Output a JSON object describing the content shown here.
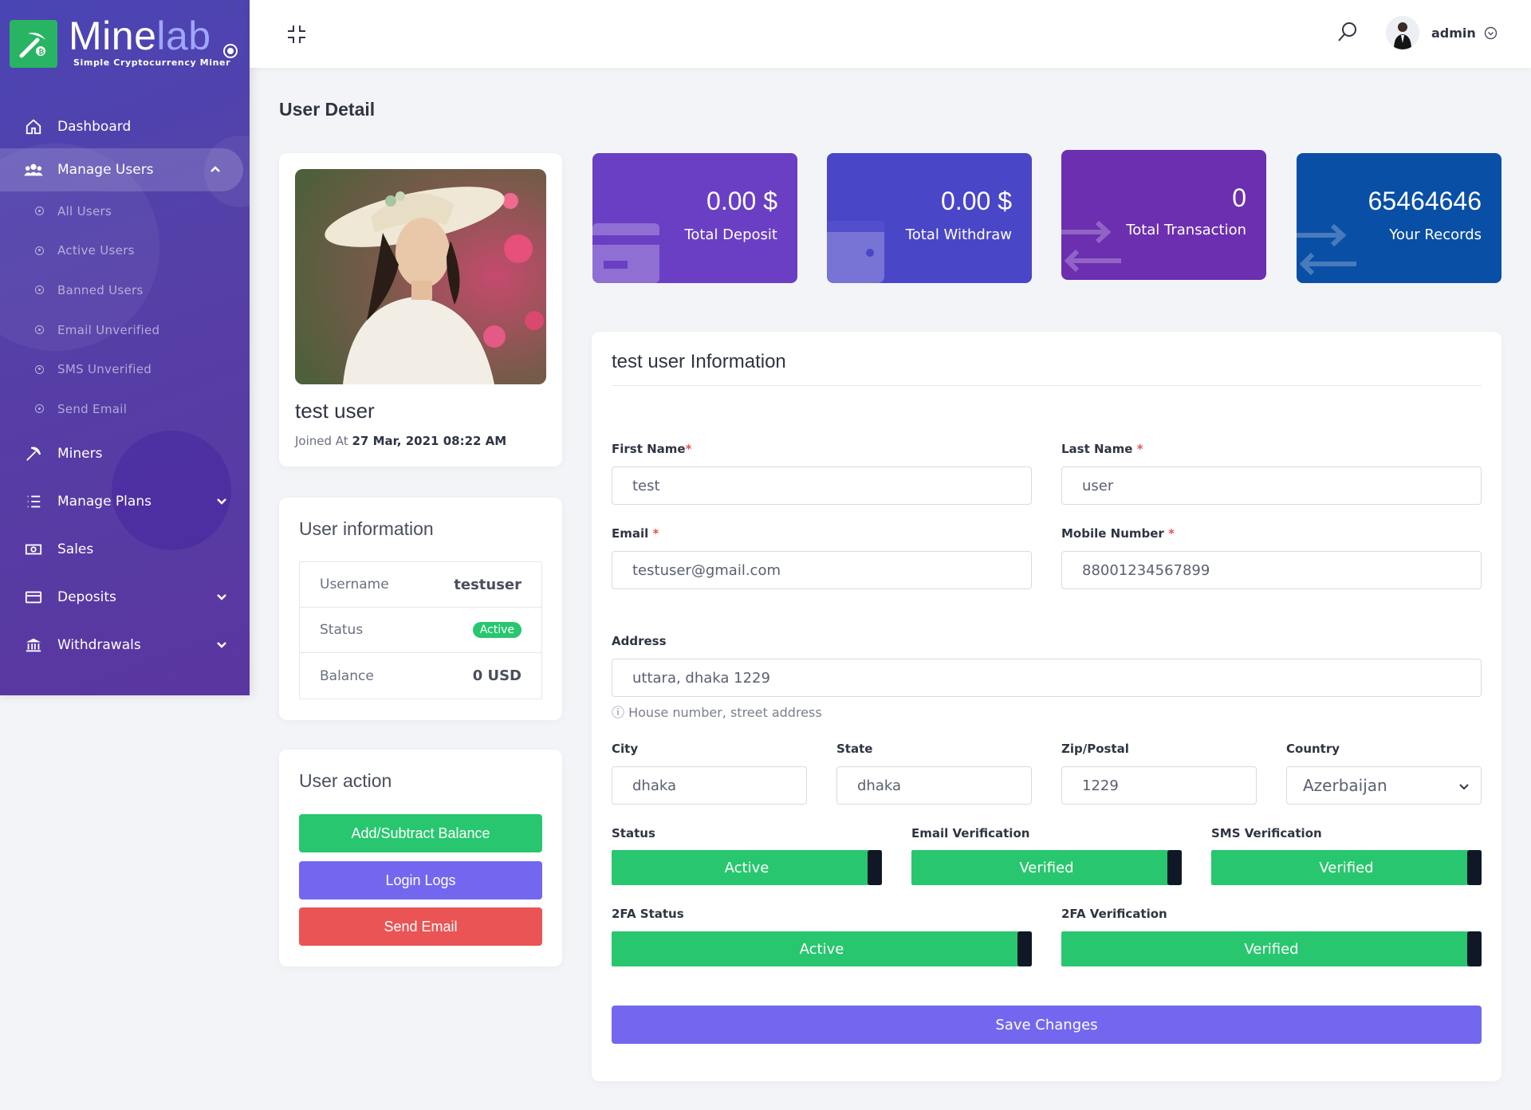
{
  "brand": {
    "name_main": "Mine",
    "name_accent": "lab",
    "tagline": "Simple Cryptocurrency Miner"
  },
  "sidebar": {
    "items": [
      {
        "label": "Dashboard",
        "icon": "home-icon"
      },
      {
        "label": "Manage Users",
        "icon": "users-icon"
      },
      {
        "label": "Miners",
        "icon": "pickaxe-icon"
      },
      {
        "label": "Manage Plans",
        "icon": "list-icon"
      },
      {
        "label": "Sales",
        "icon": "money-icon"
      },
      {
        "label": "Deposits",
        "icon": "credit-card-icon"
      },
      {
        "label": "Withdrawals",
        "icon": "bank-icon"
      }
    ],
    "subitems": [
      "All Users",
      "Active Users",
      "Banned Users",
      "Email Unverified",
      "SMS Unverified",
      "Send Email"
    ]
  },
  "header": {
    "username": "admin"
  },
  "page": {
    "title": "User Detail"
  },
  "profile": {
    "name": "test user",
    "joined_prefix": "Joined At",
    "joined_date": "27 Mar, 2021 08:22 AM"
  },
  "user_info": {
    "title": "User information",
    "rows": [
      {
        "label": "Username",
        "value": "testuser"
      },
      {
        "label": "Status",
        "value": "Active"
      },
      {
        "label": "Balance",
        "value": "0 USD"
      }
    ]
  },
  "user_action": {
    "title": "User action",
    "buttons": [
      "Add/Subtract Balance",
      "Login Logs",
      "Send Email"
    ]
  },
  "stats": [
    {
      "value": "0.00 $",
      "label": "Total Deposit"
    },
    {
      "value": "0.00 $",
      "label": "Total Withdraw"
    },
    {
      "value": "0",
      "label": "Total Transaction"
    },
    {
      "value": "65464646",
      "label": "Your Records"
    }
  ],
  "form": {
    "title": "test user Information",
    "first_name": {
      "label": "First Name",
      "value": "test"
    },
    "last_name": {
      "label": "Last Name",
      "value": "user"
    },
    "email": {
      "label": "Email",
      "value": "testuser@gmail.com"
    },
    "mobile": {
      "label": "Mobile Number",
      "value": "88001234567899"
    },
    "address": {
      "label": "Address",
      "value": "uttara, dhaka 1229",
      "hint": "House number, street address"
    },
    "city": {
      "label": "City",
      "value": "dhaka"
    },
    "state": {
      "label": "State",
      "value": "dhaka"
    },
    "zip": {
      "label": "Zip/Postal",
      "value": "1229"
    },
    "country": {
      "label": "Country",
      "value": "Azerbaijan"
    },
    "status": {
      "label": "Status",
      "value": "Active"
    },
    "email_verification": {
      "label": "Email Verification",
      "value": "Verified"
    },
    "sms_verification": {
      "label": "SMS Verification",
      "value": "Verified"
    },
    "twofa_status": {
      "label": "2FA Status",
      "value": "Active"
    },
    "twofa_verification": {
      "label": "2FA Verification",
      "value": "Verified"
    },
    "save_label": "Save Changes"
  },
  "colors": {
    "sidebar": "#4a45b4",
    "success": "#28c76f",
    "primary": "#7367f0",
    "danger": "#ea5455",
    "stat_deposit": "#6a3fc4",
    "stat_withdraw": "#4a46c8",
    "stat_transaction": "#6c2fb0",
    "stat_records": "#0a4fa6"
  }
}
